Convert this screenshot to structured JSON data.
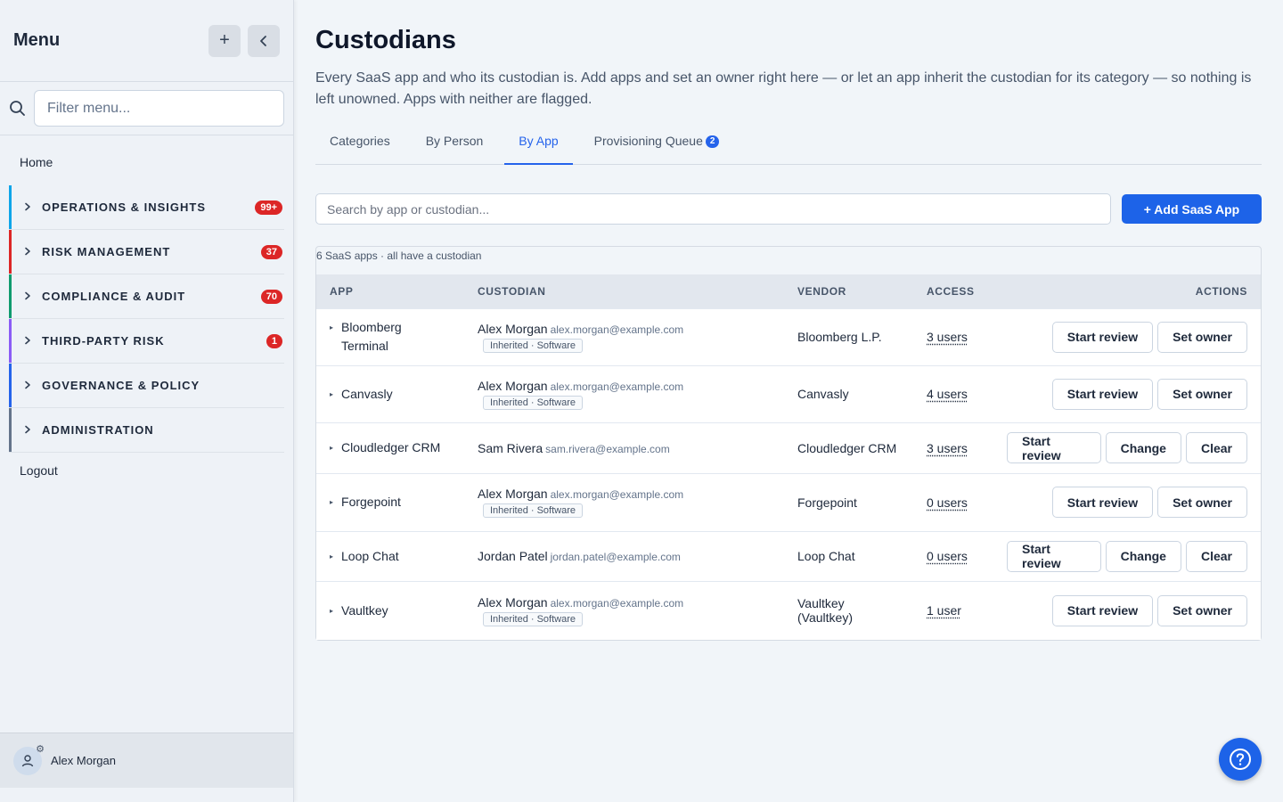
{
  "sidebar": {
    "title": "Menu",
    "add_icon": "plus-icon",
    "collapse_icon": "chevron-left-icon",
    "filter_placeholder": "Filter menu...",
    "home": "Home",
    "items": [
      {
        "label": "OPERATIONS & INSIGHTS",
        "badge": "99+",
        "color": "#0ea5e9"
      },
      {
        "label": "RISK MANAGEMENT",
        "badge": "37",
        "color": "#dc2626"
      },
      {
        "label": "COMPLIANCE & AUDIT",
        "badge": "70",
        "color": "#0f9b6e"
      },
      {
        "label": "THIRD-PARTY RISK",
        "badge": "1",
        "color": "#8b5cf6"
      },
      {
        "label": "GOVERNANCE & POLICY",
        "badge": "",
        "color": "#2563eb"
      },
      {
        "label": "ADMINISTRATION",
        "badge": "",
        "color": "#64748b"
      }
    ],
    "logout": "Logout",
    "user": "Alex Morgan"
  },
  "main": {
    "title": "Custodians",
    "description": "Every SaaS app and who its custodian is. Add apps and set an owner right here — or let an app inherit the custodian for its category — so nothing is left unowned. Apps with neither are flagged.",
    "tabs": [
      {
        "label": "Categories"
      },
      {
        "label": "By Person"
      },
      {
        "label": "By App",
        "active": true
      },
      {
        "label": "Provisioning Queue",
        "count": "2"
      }
    ],
    "search_placeholder": "Search by app or custodian...",
    "add_button": "+ Add SaaS App",
    "summary": "6 SaaS apps · all have a custodian",
    "columns": [
      "APP",
      "CUSTODIAN",
      "VENDOR",
      "ACCESS",
      "ACTIONS"
    ],
    "rows": [
      {
        "app": "Bloomberg Terminal",
        "custodian": "Alex Morgan",
        "email": "alex.morgan@example.com",
        "inherited": "Inherited · Software",
        "vendor": "Bloomberg L.P.",
        "access": "3 users",
        "actions": [
          "Start review",
          "Set owner"
        ]
      },
      {
        "app": "Canvasly",
        "custodian": "Alex Morgan",
        "email": "alex.morgan@example.com",
        "inherited": "Inherited · Software",
        "vendor": "Canvasly",
        "access": "4 users",
        "actions": [
          "Start review",
          "Set owner"
        ]
      },
      {
        "app": "Cloudledger CRM",
        "custodian": "Sam Rivera",
        "email": "sam.rivera@example.com",
        "inherited": "",
        "vendor": "Cloudledger CRM",
        "access": "3 users",
        "actions": [
          "Start review",
          "Change",
          "Clear"
        ]
      },
      {
        "app": "Forgepoint",
        "custodian": "Alex Morgan",
        "email": "alex.morgan@example.com",
        "inherited": "Inherited · Software",
        "vendor": "Forgepoint",
        "access": "0 users",
        "actions": [
          "Start review",
          "Set owner"
        ]
      },
      {
        "app": "Loop Chat",
        "custodian": "Jordan Patel",
        "email": "jordan.patel@example.com",
        "inherited": "",
        "vendor": "Loop Chat",
        "access": "0 users",
        "actions": [
          "Start review",
          "Change",
          "Clear"
        ]
      },
      {
        "app": "Vaultkey",
        "custodian": "Alex Morgan",
        "email": "alex.morgan@example.com",
        "inherited": "Inherited · Software",
        "vendor": "Vaultkey (Vaultkey)",
        "access": "1 user",
        "actions": [
          "Start review",
          "Set owner"
        ]
      }
    ]
  },
  "help_icon": "help-circle-icon"
}
